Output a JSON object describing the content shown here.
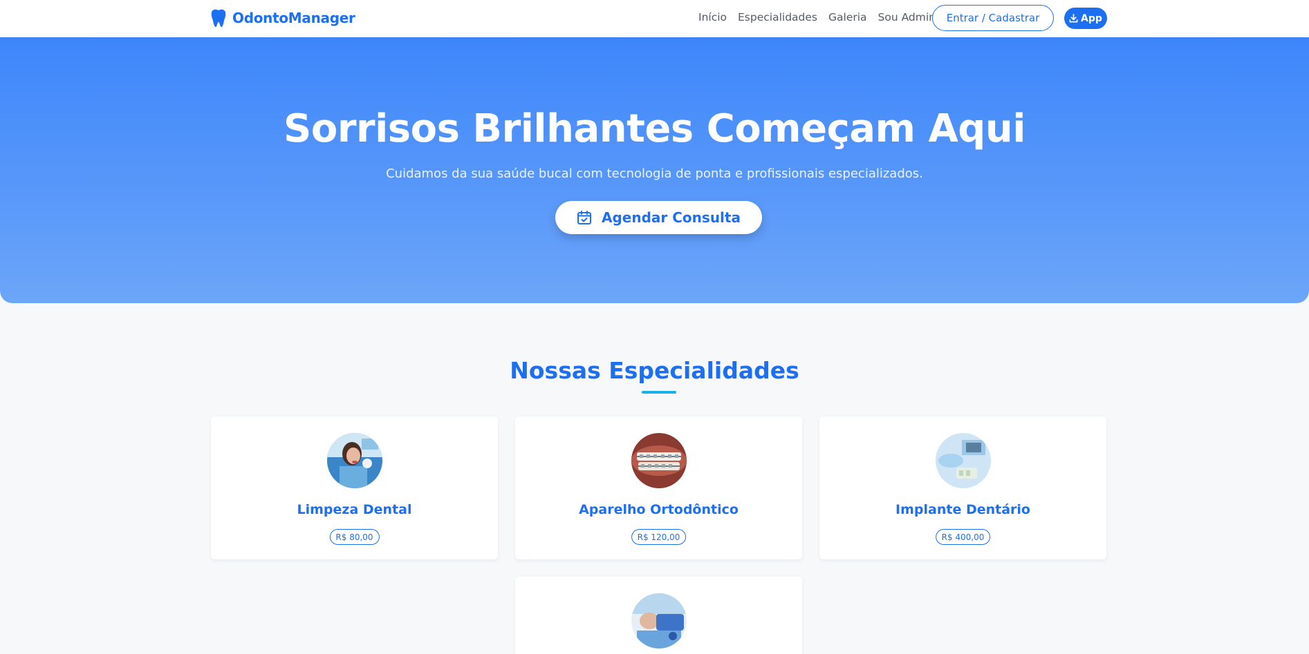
{
  "navbar": {
    "brand": "OdontoManager",
    "links": [
      "Início",
      "Especialidades",
      "Galeria",
      "Sou Admin"
    ],
    "login_label": "Entrar / Cadastrar",
    "app_label": "App"
  },
  "hero": {
    "title": "Sorrisos Brilhantes Começam Aqui",
    "subtitle": "Cuidamos da sua saúde bucal com tecnologia de ponta e profissionais especializados.",
    "cta_label": "Agendar Consulta"
  },
  "specialties": {
    "title": "Nossas Especialidades",
    "items": [
      {
        "name": "Limpeza Dental",
        "price": "R$ 80,00"
      },
      {
        "name": "Aparelho Ortodôntico",
        "price": "R$ 120,00"
      },
      {
        "name": "Implante Dentário",
        "price": "R$ 400,00"
      },
      {
        "name": "",
        "price": ""
      }
    ]
  },
  "colors": {
    "primary": "#1d6ff2",
    "hero_top": "#3d86fb",
    "hero_bottom": "#6ca6f9",
    "accent_underline": "#1ab0e8",
    "page_bg": "#f7f8fa"
  }
}
